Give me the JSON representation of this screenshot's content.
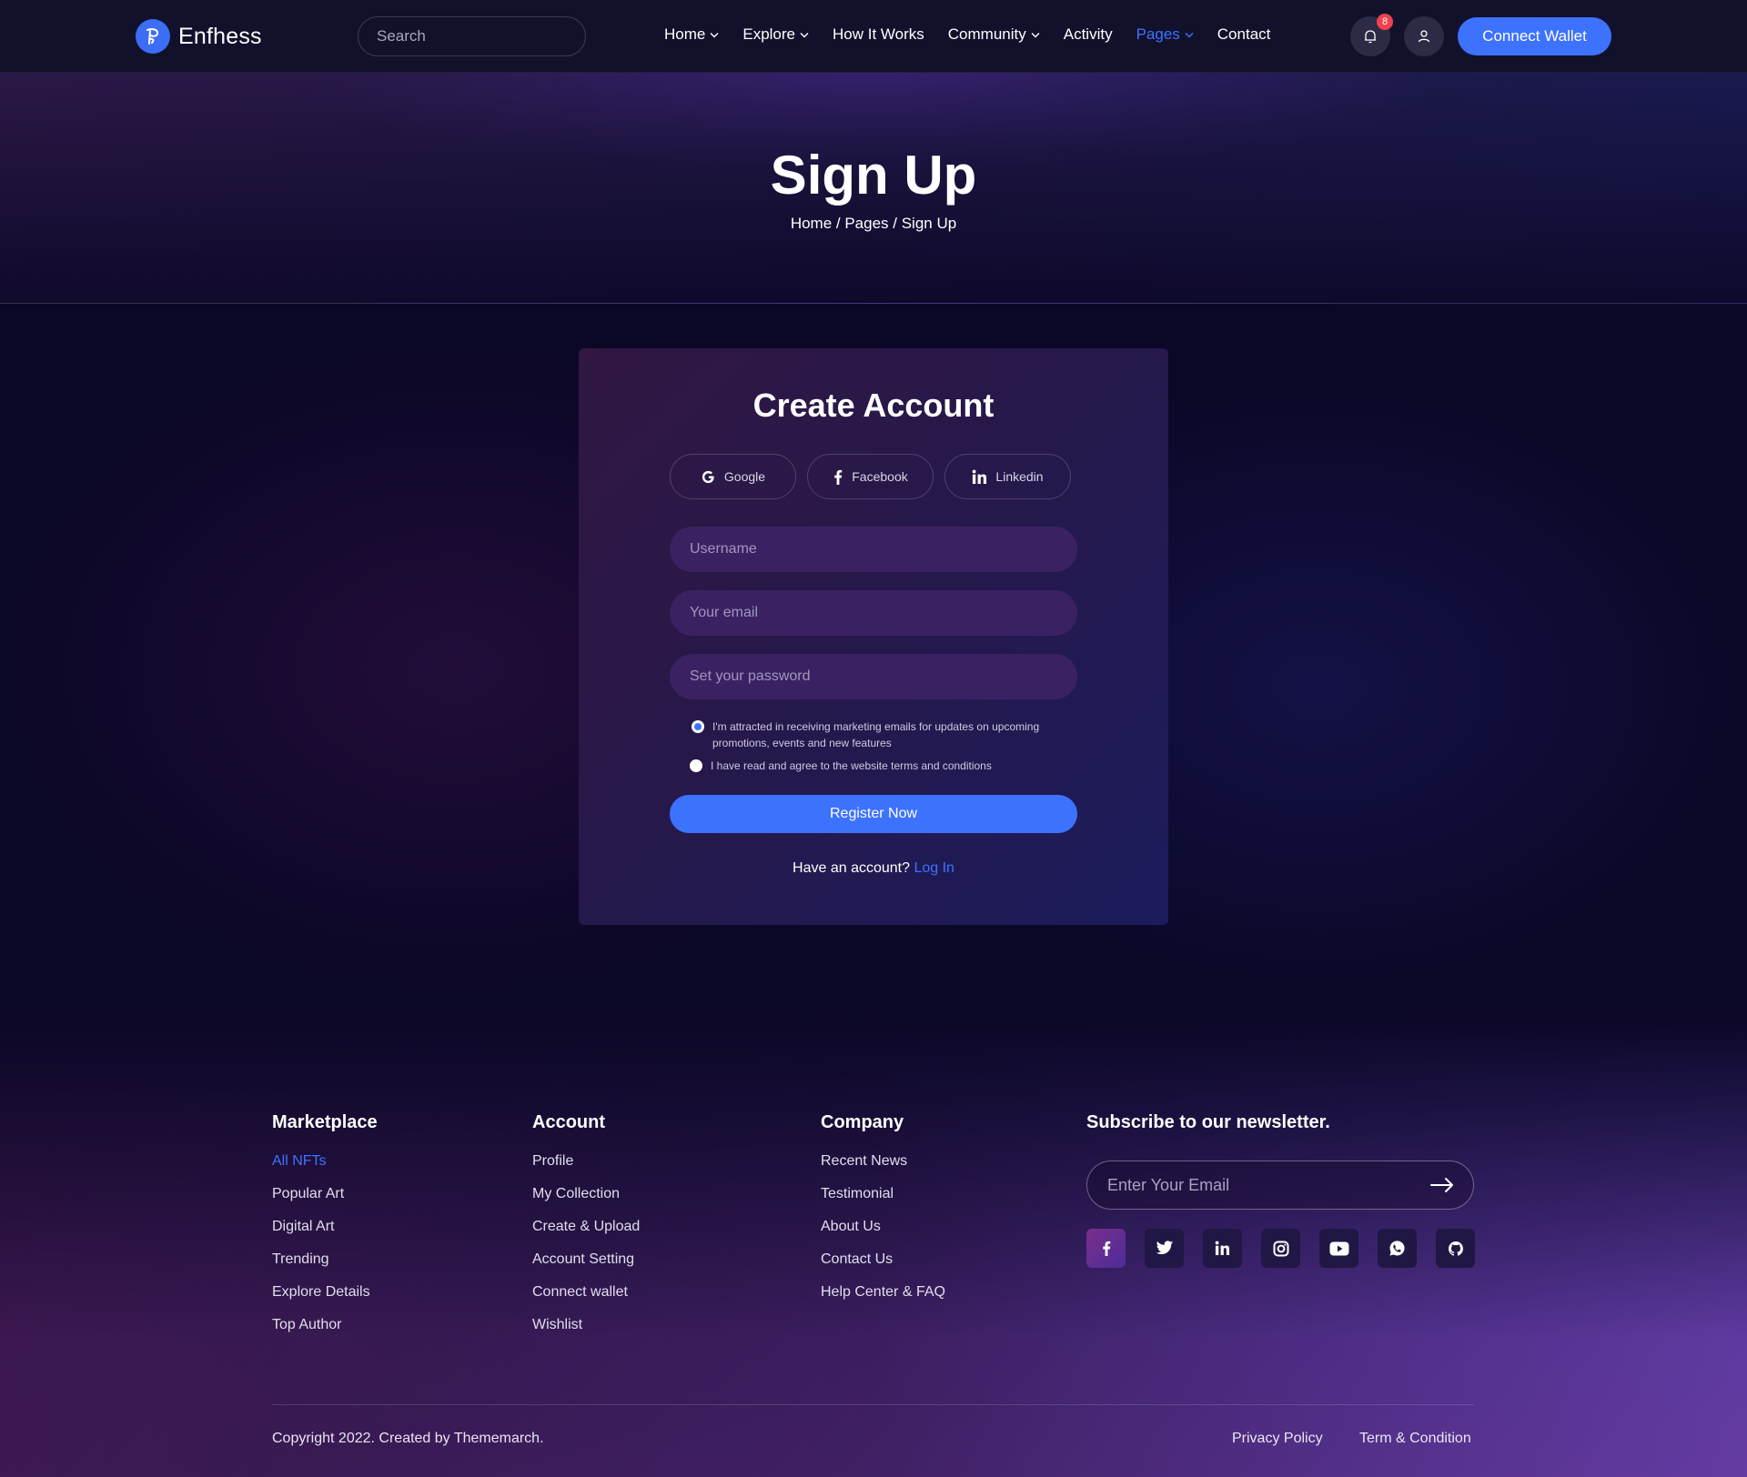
{
  "header": {
    "brand": "Enfhess",
    "search_placeholder": "Search",
    "nav": [
      {
        "label": "Home",
        "dropdown": true
      },
      {
        "label": "Explore",
        "dropdown": true
      },
      {
        "label": "How It Works",
        "dropdown": false
      },
      {
        "label": "Community",
        "dropdown": true
      },
      {
        "label": "Activity",
        "dropdown": false
      },
      {
        "label": "Pages",
        "dropdown": true,
        "active": true
      },
      {
        "label": "Contact",
        "dropdown": false
      }
    ],
    "notification_count": "8",
    "connect_label": "Connect Wallet"
  },
  "hero": {
    "title": "Sign Up",
    "breadcrumb": "Home / Pages / Sign Up"
  },
  "form": {
    "title": "Create Account",
    "social": {
      "google": "Google",
      "facebook": "Facebook",
      "linkedin": "Linkedin"
    },
    "username_placeholder": "Username",
    "email_placeholder": "Your email",
    "password_placeholder": "Set your password",
    "marketing_consent": "I'm attracted in receiving marketing emails for updates on upcoming promotions, events and new features",
    "marketing_checked": true,
    "terms_consent": "I have read and agree to the website terms and conditions",
    "terms_checked": false,
    "register_label": "Register Now",
    "have_account": "Have an account?",
    "login_link": "Log In"
  },
  "footer": {
    "marketplace": {
      "title": "Marketplace",
      "links": [
        "All NFTs",
        "Popular Art",
        "Digital Art",
        "Trending",
        "Explore Details",
        "Top Author"
      ]
    },
    "account": {
      "title": "Account",
      "links": [
        "Profile",
        "My Collection",
        "Create & Upload",
        "Account Setting",
        "Connect wallet",
        "Wishlist"
      ]
    },
    "company": {
      "title": "Company",
      "links": [
        "Recent News",
        "Testimonial",
        "About Us",
        "Contact Us",
        "Help Center & FAQ"
      ]
    },
    "newsletter": {
      "title": "Subscribe to our newsletter.",
      "placeholder": "Enter Your Email"
    },
    "social_icons": [
      "facebook-icon",
      "twitter-icon",
      "linkedin-icon",
      "instagram-icon",
      "youtube-icon",
      "whatsapp-icon",
      "github-icon"
    ],
    "copyright": "Copyright 2022. Created by Thememarch.",
    "privacy": "Privacy Policy",
    "terms": "Term & Condition"
  },
  "colors": {
    "accent": "#3d72ff",
    "header_bg": "#12112c",
    "page_bg": "#0b0726",
    "badge": "#f0424c"
  }
}
